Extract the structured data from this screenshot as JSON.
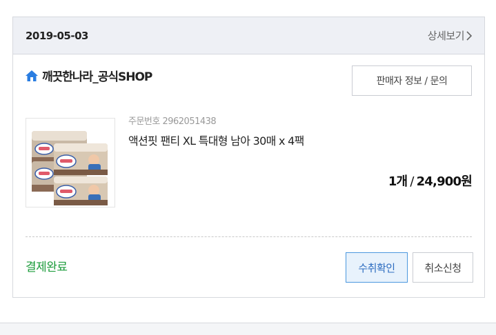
{
  "order": {
    "date": "2019-05-03",
    "detail_link": "상세보기",
    "seller": {
      "name": "깨끗한나라_공식SHOP",
      "info_button": "판매자 정보 / 문의"
    },
    "product": {
      "order_number": "주문번호 2962051438",
      "name": "액션핏 팬티 XL 특대형 남아 30매 x 4팩",
      "quantity": "1개",
      "price": "24,900원"
    },
    "status": "결제완료",
    "buttons": {
      "confirm": "수취확인",
      "cancel": "취소신청"
    }
  },
  "colors": {
    "header_bg": "#eef0f5",
    "status_green": "#1a9b3a",
    "confirm_border": "#4a97de",
    "confirm_bg": "#e8f2fc",
    "home_icon": "#2a7de1"
  },
  "icons": {
    "shop": "home-icon",
    "detail": "chevron-right-icon"
  }
}
